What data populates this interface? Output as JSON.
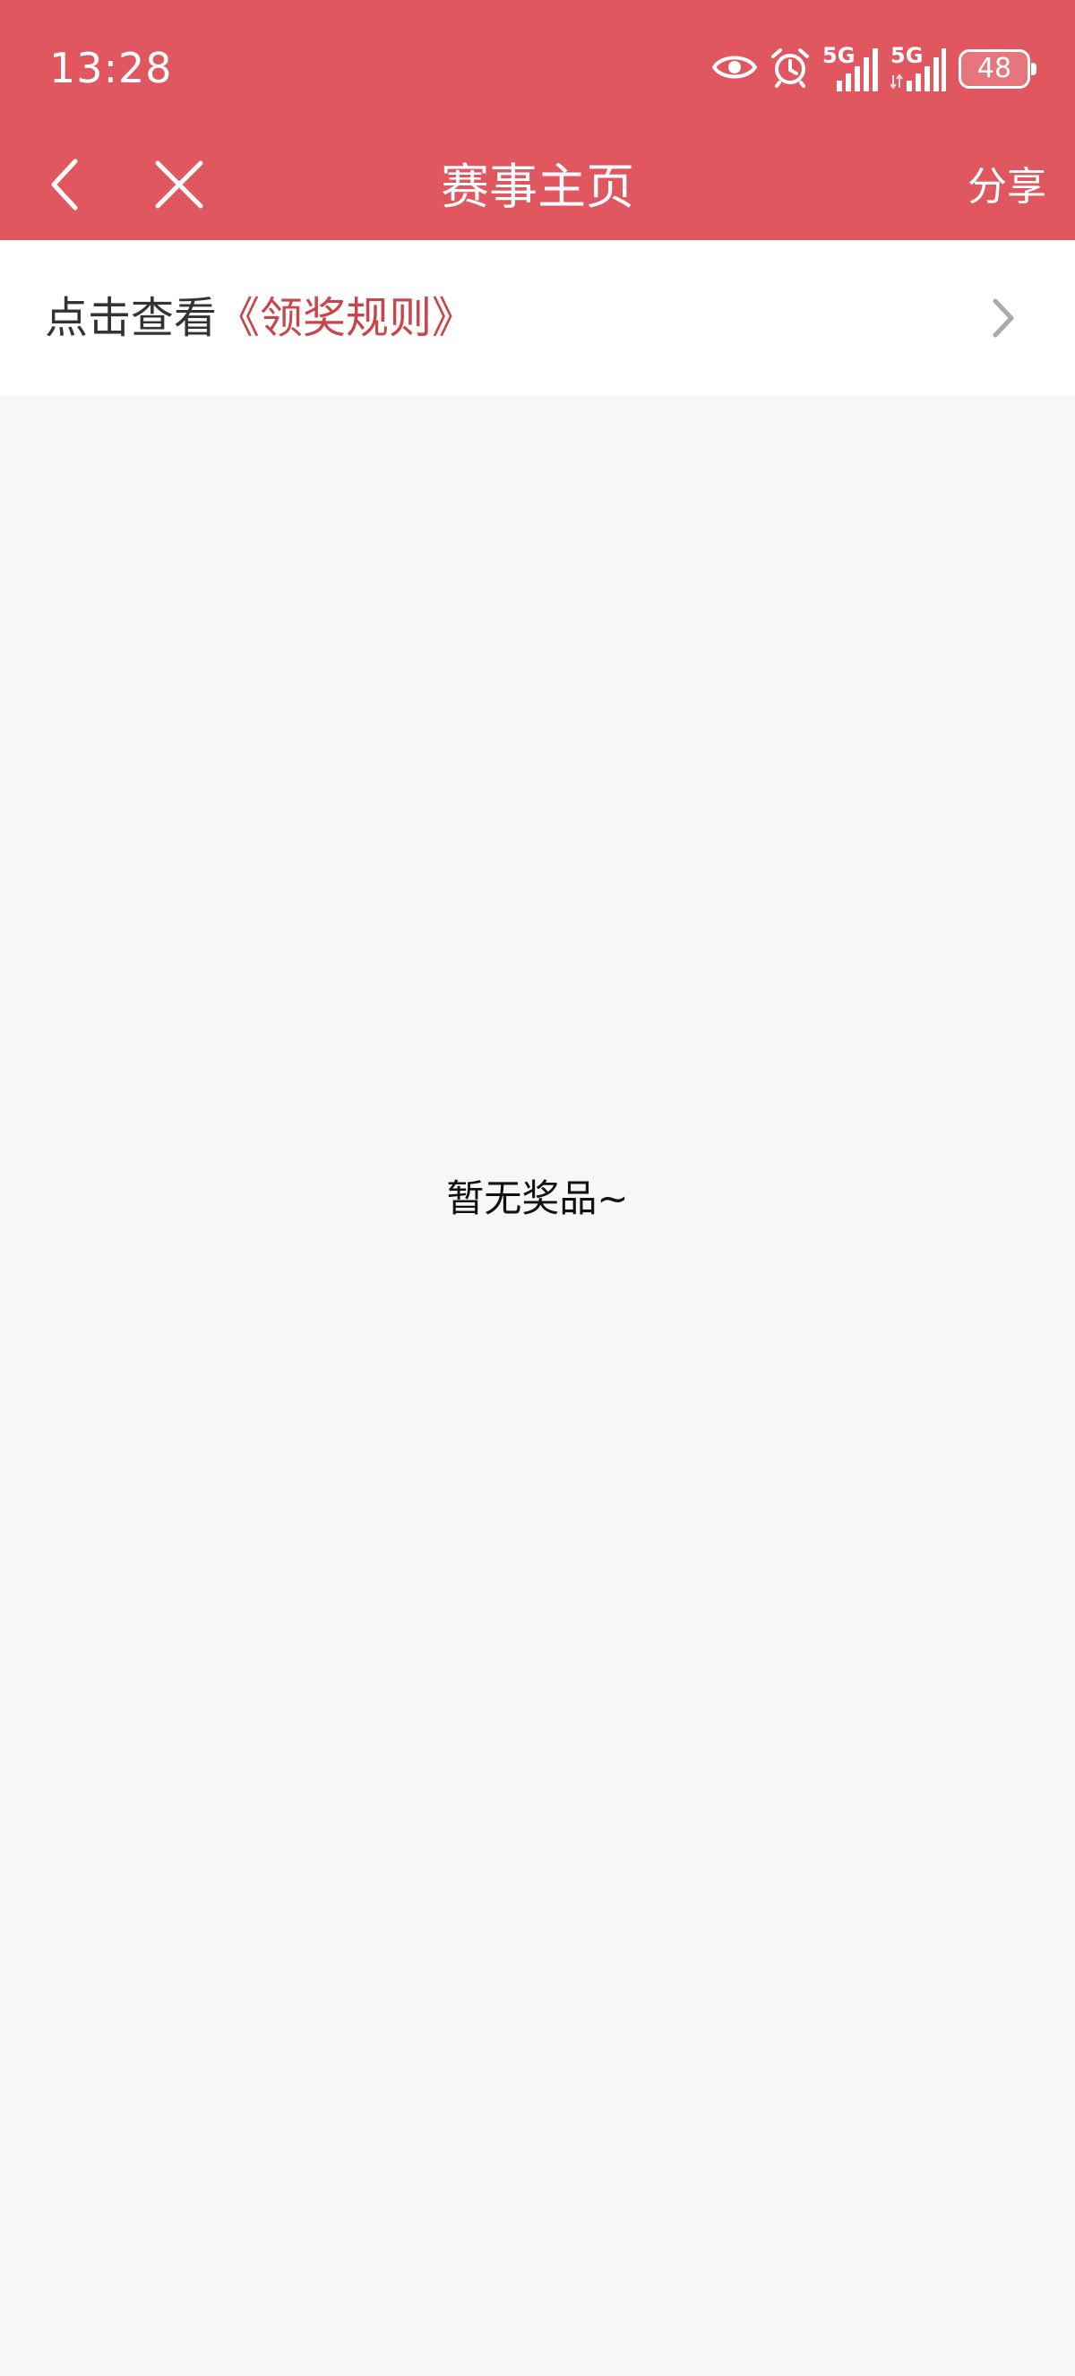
{
  "status_bar": {
    "time": "13:28",
    "signal_1_label": "5G",
    "signal_2_label": "5G",
    "battery": "48",
    "icons": [
      "eye-icon",
      "alarm-icon",
      "signal-icon",
      "signal-icon",
      "battery-icon"
    ]
  },
  "nav": {
    "title": "赛事主页",
    "share_label": "分享",
    "back_icon": "chevron-left-icon",
    "close_icon": "close-icon"
  },
  "rules": {
    "prefix": "点击查看",
    "link_text": "《领奖规则》",
    "chevron_icon": "chevron-right-icon"
  },
  "empty_state": {
    "message": "暂无奖品~"
  },
  "colors": {
    "header_bg": "#e15760",
    "link": "#c9454b",
    "page_bg": "#f7f7f7"
  }
}
